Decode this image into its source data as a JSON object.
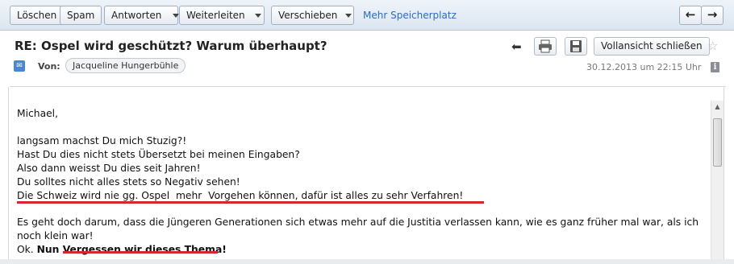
{
  "toolbar": {
    "delete_label": "Löschen",
    "spam_label": "Spam",
    "reply_label": "Antworten",
    "forward_label": "Weiterleiten",
    "move_label": "Verschieben",
    "more_storage_link": "Mehr Speicherplatz"
  },
  "header": {
    "subject": "RE: Ospel wird geschützt? Warum überhaupt?",
    "from_label": "Von:",
    "from_name": "Jacqueline Hungerbühle",
    "datetime": "30.12.2013 um 22:15 Uhr",
    "fullview_label": "Vollansicht schließen"
  },
  "body": {
    "salutation": "Michael,",
    "lines": [
      "langsam machst Du mich Stuzig?!",
      "Hast Du dies nicht stets Übersetzt bei meinen Eingaben?",
      "Also dann weisst Du dies seit Jahren!",
      "Du solltes nicht alles stets so Negativ sehen!",
      "Die Schweiz wird nie gg. Ospel  mehr  Vorgehen können, dafür ist alles zu sehr Verfahren!"
    ],
    "paragraph2": "Es geht doch darum, dass die Jüngeren Generationen sich etwas mehr auf die Justitia verlassen kann, wie es ganz früher mal war, als ich noch klein war!",
    "closing_prefix": "Ok. ",
    "closing_bold": "Nun Vergessen wir dieses Thema!"
  },
  "colors": {
    "underline": "#d8262c",
    "link": "#2a6cc0",
    "toolbar_bg": "#dce6f1"
  },
  "icons": {
    "print": "print-icon",
    "save": "save-icon",
    "back": "arrow-left-icon",
    "star": "star-icon",
    "info": "info-icon",
    "nav_prev": "arrow-left-icon",
    "nav_next": "arrow-right-icon"
  }
}
